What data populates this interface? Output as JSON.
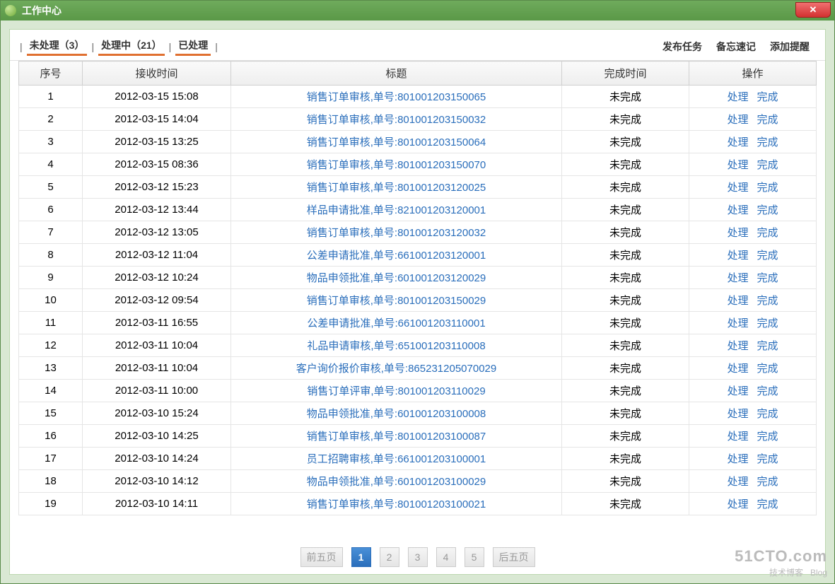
{
  "window": {
    "title": "工作中心"
  },
  "tabs": [
    {
      "label": "未处理（3）"
    },
    {
      "label": "处理中（21）"
    },
    {
      "label": "已处理"
    }
  ],
  "actions": {
    "publish": "发布任务",
    "memo": "备忘速记",
    "reminder": "添加提醒"
  },
  "columns": {
    "seq": "序号",
    "recv_time": "接收时间",
    "title": "标题",
    "done_time": "完成时间",
    "ops": "操作"
  },
  "row_ops": {
    "process": "处理",
    "finish": "完成"
  },
  "status_unfinished": "未完成",
  "rows": [
    {
      "seq": "1",
      "recv": "2012-03-15 15:08",
      "title": "销售订单审核,单号:801001203150065",
      "done": "未完成"
    },
    {
      "seq": "2",
      "recv": "2012-03-15 14:04",
      "title": "销售订单审核,单号:801001203150032",
      "done": "未完成"
    },
    {
      "seq": "3",
      "recv": "2012-03-15 13:25",
      "title": "销售订单审核,单号:801001203150064",
      "done": "未完成"
    },
    {
      "seq": "4",
      "recv": "2012-03-15 08:36",
      "title": "销售订单审核,单号:801001203150070",
      "done": "未完成"
    },
    {
      "seq": "5",
      "recv": "2012-03-12 15:23",
      "title": "销售订单审核,单号:801001203120025",
      "done": "未完成"
    },
    {
      "seq": "6",
      "recv": "2012-03-12 13:44",
      "title": "样品申请批准,单号:821001203120001",
      "done": "未完成"
    },
    {
      "seq": "7",
      "recv": "2012-03-12 13:05",
      "title": "销售订单审核,单号:801001203120032",
      "done": "未完成"
    },
    {
      "seq": "8",
      "recv": "2012-03-12 11:04",
      "title": "公差申请批准,单号:661001203120001",
      "done": "未完成"
    },
    {
      "seq": "9",
      "recv": "2012-03-12 10:24",
      "title": "物品申领批准,单号:601001203120029",
      "done": "未完成"
    },
    {
      "seq": "10",
      "recv": "2012-03-12 09:54",
      "title": "销售订单审核,单号:801001203150029",
      "done": "未完成"
    },
    {
      "seq": "11",
      "recv": "2012-03-11 16:55",
      "title": "公差申请批准,单号:661001203110001",
      "done": "未完成"
    },
    {
      "seq": "12",
      "recv": "2012-03-11 10:04",
      "title": "礼品申请审核,单号:651001203110008",
      "done": "未完成"
    },
    {
      "seq": "13",
      "recv": "2012-03-11 10:04",
      "title": "客户询价报价审核,单号:865231205070029",
      "done": "未完成"
    },
    {
      "seq": "14",
      "recv": "2012-03-11 10:00",
      "title": "销售订单评审,单号:801001203110029",
      "done": "未完成"
    },
    {
      "seq": "15",
      "recv": "2012-03-10 15:24",
      "title": "物品申领批准,单号:601001203100008",
      "done": "未完成"
    },
    {
      "seq": "16",
      "recv": "2012-03-10 14:25",
      "title": "销售订单审核,单号:801001203100087",
      "done": "未完成"
    },
    {
      "seq": "17",
      "recv": "2012-03-10 14:24",
      "title": "员工招聘审核,单号:661001203100001",
      "done": "未完成"
    },
    {
      "seq": "18",
      "recv": "2012-03-10 14:12",
      "title": "物品申领批准,单号:601001203100029",
      "done": "未完成"
    },
    {
      "seq": "19",
      "recv": "2012-03-10 14:11",
      "title": "销售订单审核,单号:801001203100021",
      "done": "未完成"
    }
  ],
  "pager": {
    "prev5": "前五页",
    "next5": "后五页",
    "pages": [
      "1",
      "2",
      "3",
      "4",
      "5"
    ],
    "active": 0
  },
  "watermark": {
    "line1": "51CTO.com",
    "line2": "技术博客",
    "line3": "Blog"
  }
}
